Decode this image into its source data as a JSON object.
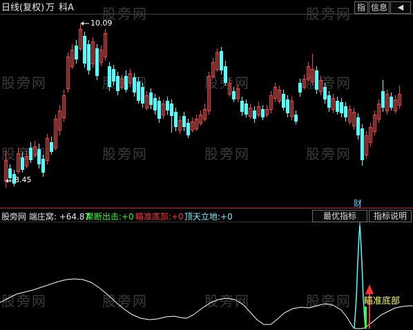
{
  "header": {
    "title": "日线(复权)",
    "unit": "万",
    "stock": "科A",
    "btn_zhi": "指",
    "btn_info": "信息",
    "btn_arrow": "◀"
  },
  "watermark": "股旁网",
  "price": {
    "high_label": "10.09",
    "low_label": "8.45"
  },
  "indicator": {
    "name_label": "股旁网 端庄窝:",
    "name_value": "+64.87",
    "legend": [
      {
        "label": "果断出击:",
        "value": "+0",
        "color": "#32ff32"
      },
      {
        "label": "瞄准底部:",
        "value": "+0",
        "color": "#ff3232"
      },
      {
        "label": "顶天立地:",
        "value": "+0",
        "color": "#7ef3ff"
      }
    ],
    "btn_best": "最优指标",
    "btn_explain": "指标说明",
    "marker_cai": "财",
    "signal_text": "瞄准底部"
  },
  "colors": {
    "up": "#ff3c3c",
    "down": "#54ffff",
    "bg": "#000000",
    "indicator_line": "#ffffff",
    "spike": "#54ffff",
    "signal_text": "#ffff55"
  }
}
